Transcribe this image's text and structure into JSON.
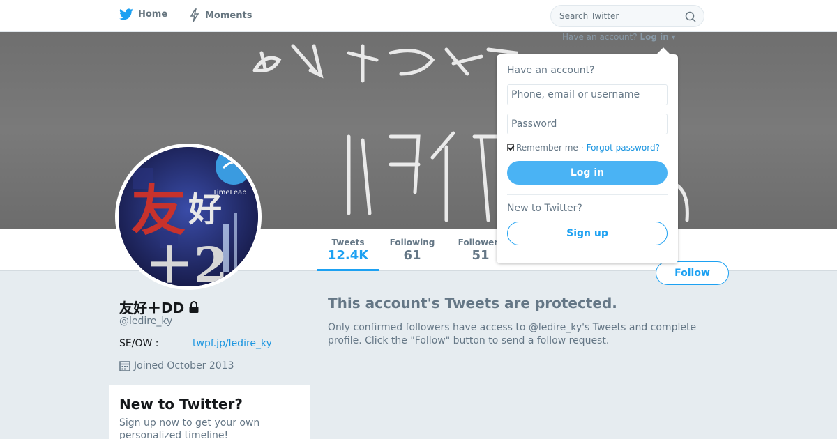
{
  "nav": {
    "home_label": "Home",
    "moments_label": "Moments",
    "search_placeholder": "Search Twitter"
  },
  "login_hint": {
    "prefix": "Have an account?",
    "link": "Log in"
  },
  "login_dropdown": {
    "title": "Have an account?",
    "username_placeholder": "Phone, email or username",
    "password_placeholder": "Password",
    "remember_label": "Remember me",
    "separator": "·",
    "forgot_label": "Forgot password?",
    "login_button": "Log in",
    "new_label": "New to Twitter?",
    "signup_button": "Sign up"
  },
  "profile_nav": {
    "tweets": {
      "label": "Tweets",
      "value": "12.4K"
    },
    "following": {
      "label": "Following",
      "value": "61"
    },
    "followers": {
      "label": "Followers",
      "value": "51"
    },
    "follow_button": "Follow"
  },
  "profile": {
    "name": "友好＋DD",
    "handle": "@ledire_ky",
    "bio_label": "SE/OW :",
    "bio_link": "twpf.jp/ledire_ky",
    "joined": "Joined October 2013"
  },
  "signup_card": {
    "title": "New to Twitter?",
    "text": "Sign up now to get your own personalized timeline!"
  },
  "protected": {
    "title": "This account's Tweets are protected.",
    "text": "Only confirmed followers have access to @ledire_ky's Tweets and complete profile. Click the \"Follow\" button to send a follow request."
  },
  "avatar_art": {
    "glyph_1": "友",
    "glyph_2": "好",
    "glyph_3": "＋2",
    "badge": "TimeLeap"
  },
  "colors": {
    "accent": "#1da1f2",
    "background": "#e6ecf0",
    "muted_text": "#657786"
  }
}
